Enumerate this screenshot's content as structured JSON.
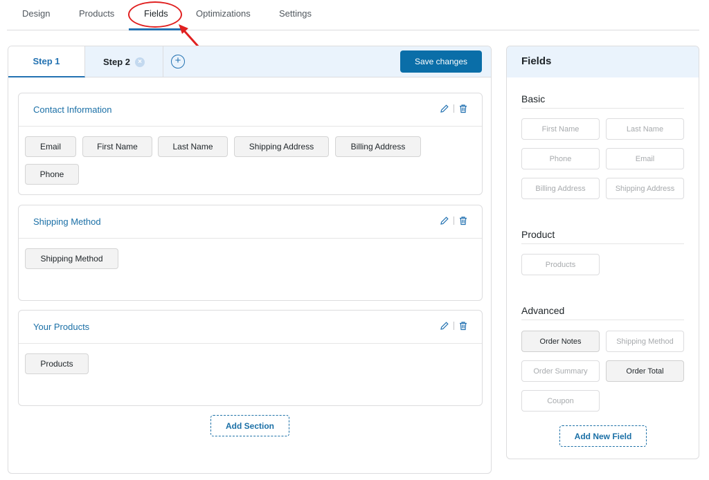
{
  "top_nav": {
    "tabs": [
      "Design",
      "Products",
      "Fields",
      "Optimizations",
      "Settings"
    ],
    "active": "Fields"
  },
  "steps": {
    "tabs": [
      "Step 1",
      "Step 2"
    ],
    "close_icon": "×",
    "add_icon": "+",
    "save_label": "Save changes"
  },
  "sections": [
    {
      "title": "Contact Information",
      "fields": [
        "Email",
        "First Name",
        "Last Name",
        "Shipping Address",
        "Billing Address",
        "Phone"
      ]
    },
    {
      "title": "Shipping Method",
      "fields": [
        "Shipping Method"
      ]
    },
    {
      "title": "Your Products",
      "fields": [
        "Products"
      ]
    }
  ],
  "add_section_label": "Add Section",
  "fields_panel": {
    "title": "Fields",
    "groups": [
      {
        "name": "Basic",
        "fields": [
          "First Name",
          "Last Name",
          "Phone",
          "Email",
          "Billing Address",
          "Shipping Address"
        ]
      },
      {
        "name": "Product",
        "fields": [
          "Products"
        ]
      },
      {
        "name": "Advanced",
        "fields": [
          "Order Notes",
          "Shipping Method",
          "Order Summary",
          "Order Total",
          "Coupon"
        ]
      }
    ],
    "add_field_label": "Add New Field"
  },
  "colors": {
    "accent": "#2271b1",
    "save_button": "#0a6ea8",
    "annotation": "#e02020",
    "panel_header": "#eaf3fc"
  },
  "icons": {
    "edit": "pencil-icon",
    "delete": "trash-icon"
  }
}
